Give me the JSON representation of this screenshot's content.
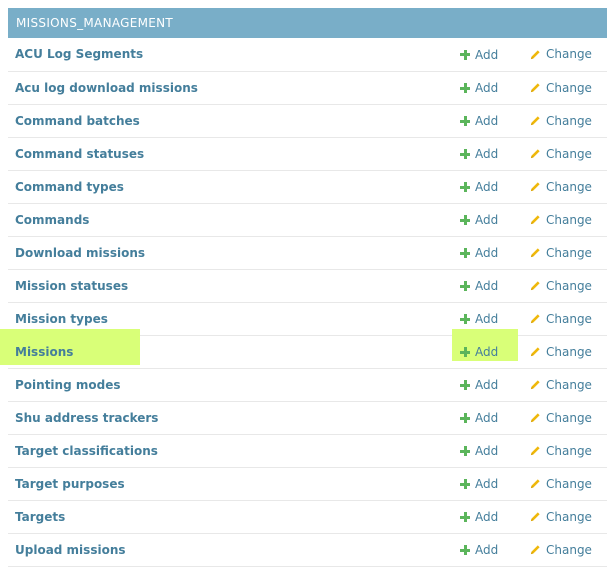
{
  "module": {
    "caption": "MISSIONS_MANAGEMENT",
    "add_label": "Add",
    "change_label": "Change",
    "colors": {
      "caption_bg": "#79aec8",
      "link": "#447e9b",
      "add_icon": "#5bb55b",
      "change_icon": "#efb80b",
      "highlight": "#d9ff78"
    },
    "rows": [
      {
        "name": "ACU Log Segments"
      },
      {
        "name": "Acu log download missions"
      },
      {
        "name": "Command batches"
      },
      {
        "name": "Command statuses"
      },
      {
        "name": "Command types"
      },
      {
        "name": "Commands"
      },
      {
        "name": "Download missions"
      },
      {
        "name": "Mission statuses"
      },
      {
        "name": "Mission types"
      },
      {
        "name": "Missions",
        "highlighted": true
      },
      {
        "name": "Pointing modes"
      },
      {
        "name": "Shu address trackers"
      },
      {
        "name": "Target classifications"
      },
      {
        "name": "Target purposes"
      },
      {
        "name": "Targets"
      },
      {
        "name": "Upload missions"
      }
    ]
  }
}
